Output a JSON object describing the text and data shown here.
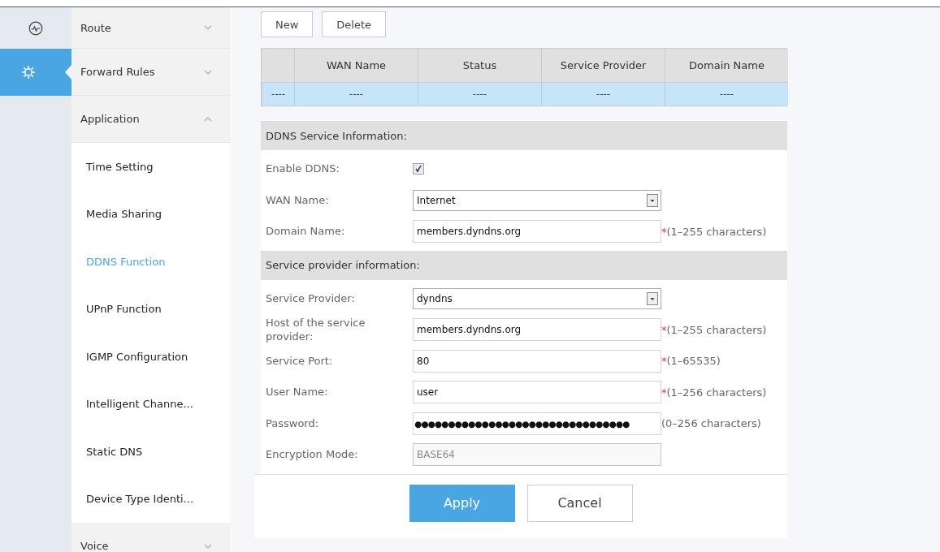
{
  "rail": [
    {
      "kind": "monitor",
      "selected": false
    },
    {
      "kind": "settings",
      "selected": true
    }
  ],
  "menu": [
    {
      "label": "Route",
      "expanded": false
    },
    {
      "label": "Forward Rules",
      "expanded": false
    },
    {
      "label": "Application",
      "expanded": true,
      "children": [
        {
          "label": "Time Setting",
          "selected": false
        },
        {
          "label": "Media Sharing",
          "selected": false
        },
        {
          "label": "DDNS Function",
          "selected": true
        },
        {
          "label": "UPnP Function",
          "selected": false
        },
        {
          "label": "IGMP Configuration",
          "selected": false
        },
        {
          "label": "Intelligent Channe...",
          "selected": false
        },
        {
          "label": "Static DNS",
          "selected": false
        },
        {
          "label": "Device Type Identi...",
          "selected": false
        }
      ]
    },
    {
      "label": "Voice",
      "expanded": false
    }
  ],
  "toolbar": [
    "New",
    "Delete"
  ],
  "table": {
    "columns": [
      "",
      "WAN Name",
      "Status",
      "Service Provider",
      "Domain Name"
    ],
    "rows": [
      {
        "selected": true,
        "cells": [
          "----",
          "----",
          "----",
          "----",
          "----"
        ]
      }
    ]
  },
  "sections": [
    {
      "title": "DDNS Service Information:",
      "fields": [
        {
          "kind": "checkbox",
          "label": "Enable DDNS:",
          "checked": true
        },
        {
          "kind": "select",
          "label": "WAN Name:",
          "value": "Internet"
        },
        {
          "kind": "text",
          "label": "Domain Name:",
          "value": "members.dyndns.org",
          "disabled": false,
          "mark": "*",
          "hint": "(1–255 characters)"
        }
      ]
    },
    {
      "title": "Service provider information:",
      "fields": [
        {
          "kind": "select",
          "label": "Service Provider:",
          "value": "dyndns"
        },
        {
          "kind": "text",
          "label": "Host of the service provider:",
          "value": "members.dyndns.org",
          "disabled": false,
          "mark": "*",
          "hint": "(1–255 characters)"
        },
        {
          "kind": "text",
          "label": "Service Port:",
          "value": "80",
          "disabled": false,
          "mark": "*",
          "hint": "(1–65535)"
        },
        {
          "kind": "text",
          "label": "User Name:",
          "value": "user",
          "disabled": false,
          "mark": "*",
          "hint": "(1–256 characters)"
        },
        {
          "kind": "password",
          "label": "Password:",
          "value": "●●●●●●●●●●●●●●●●●●●●●●●●●●●●●●●●",
          "hint": "(0–256 characters)"
        },
        {
          "kind": "text",
          "label": "Encryption Mode:",
          "value": "BASE64",
          "disabled": true
        }
      ]
    }
  ],
  "actions": [
    {
      "label": "Apply",
      "kind": "primary"
    },
    {
      "label": "Cancel",
      "kind": "secondary"
    }
  ]
}
